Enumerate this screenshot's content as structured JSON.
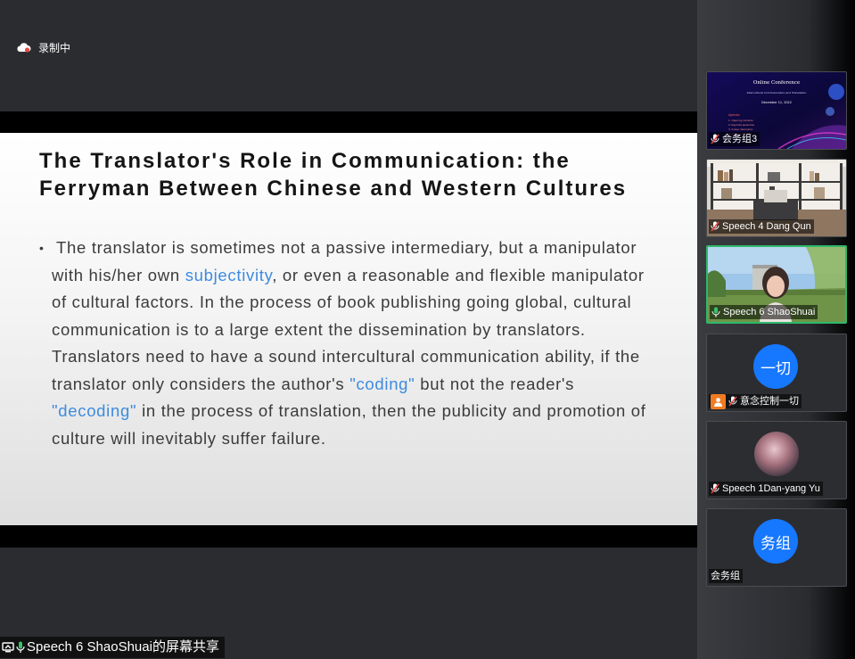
{
  "recording": {
    "label": "录制中"
  },
  "slide": {
    "title": "The Translator's Role in Communication: the Ferryman Between Chinese and Western Cultures",
    "bullet": "•",
    "body": {
      "p1": "The translator is sometimes not a passive intermediary, but a manipulator with his/her own ",
      "hl1": "subjectivity",
      "p2": ", or even a reasonable and flexible manipulator of cultural factors. In the process of book publishing going global, cultural communication is to a large extent the dissemination by translators. Translators need to have a sound intercultural communication ability, if the translator only considers the author's ",
      "hl2": "\"coding\"",
      "p3": " but not the reader's ",
      "hl3": "\"decoding\"",
      "p4": " in the process of translation, then the publicity and promotion of culture will inevitably suffer failure."
    }
  },
  "share": {
    "label": "Speech 6 ShaoShuai的屏幕共享"
  },
  "participants": [
    {
      "name": "会务组3",
      "type": "screen",
      "screen": {
        "title": "Online Conference",
        "subtitle": "Intercultural Communication and Translation",
        "date": "December 11, 2022",
        "agenda": [
          "Agenda:",
          "1. Opening remarks",
          "2. Keynote speeches",
          "3. Group discussion",
          "4. Closing remarks"
        ]
      }
    },
    {
      "name": "Speech 4 Dang Qun",
      "type": "camera-shelf"
    },
    {
      "name": "Speech 6 ShaoShuai",
      "type": "camera-person",
      "active": true
    },
    {
      "name": "意念控制一切",
      "type": "avatar",
      "avatar_text": "一切"
    },
    {
      "name": "Speech 1Dan-yang Yu",
      "type": "photo"
    },
    {
      "name": "会务组",
      "type": "avatar",
      "avatar_text": "务组"
    }
  ],
  "colors": {
    "accent_blue": "#1677ff",
    "active_green": "#2fb86b",
    "link_blue": "#3d8be0",
    "person_orange": "#f07b21"
  }
}
